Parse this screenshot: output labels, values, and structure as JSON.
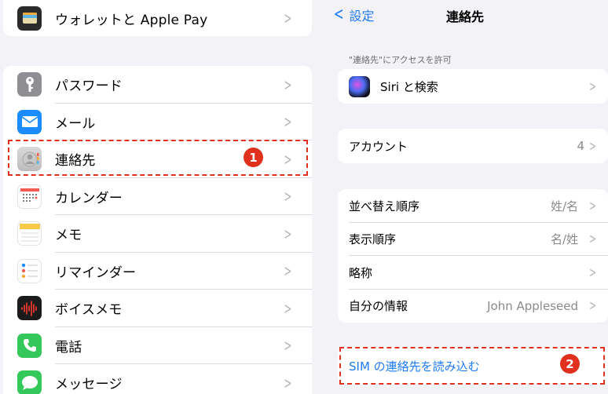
{
  "left": {
    "top_item": {
      "label": "ウォレットと Apple Pay",
      "icon": "wallet-icon"
    },
    "items": [
      {
        "label": "パスワード",
        "icon": "key-icon"
      },
      {
        "label": "メール",
        "icon": "mail-icon"
      },
      {
        "label": "連絡先",
        "icon": "contacts-icon"
      },
      {
        "label": "カレンダー",
        "icon": "calendar-icon"
      },
      {
        "label": "メモ",
        "icon": "notes-icon"
      },
      {
        "label": "リマインダー",
        "icon": "reminders-icon"
      },
      {
        "label": "ボイスメモ",
        "icon": "voice-memos-icon"
      },
      {
        "label": "電話",
        "icon": "phone-icon"
      },
      {
        "label": "メッセージ",
        "icon": "messages-icon"
      }
    ]
  },
  "right": {
    "back_label": "設定",
    "title": "連絡先",
    "section_caption": "\"連絡先\"にアクセスを許可",
    "siri_label": "Siri と検索",
    "account": {
      "label": "アカウント",
      "value": "4"
    },
    "options": [
      {
        "label": "並べ替え順序",
        "value": "姓/名"
      },
      {
        "label": "表示順序",
        "value": "名/姓"
      },
      {
        "label": "略称",
        "value": ""
      },
      {
        "label": "自分の情報",
        "value": "John Appleseed"
      }
    ],
    "sim_import": "SIM の連絡先を読み込む"
  },
  "annotations": {
    "badge1": "1",
    "badge2": "2",
    "color": "#e0301e"
  },
  "colors": {
    "accent": "#1f7bf6",
    "background": "#f2f2f7"
  }
}
